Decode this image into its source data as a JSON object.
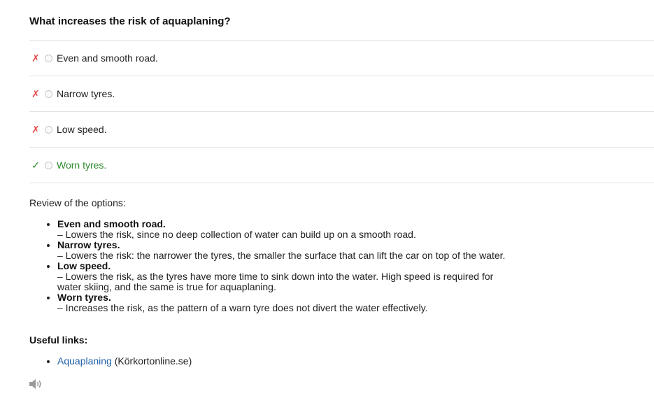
{
  "question": "What increases the risk of aquaplaning?",
  "options": [
    {
      "mark": "✗",
      "text": "Even and smooth road.",
      "correct": false
    },
    {
      "mark": "✗",
      "text": "Narrow tyres.",
      "correct": false
    },
    {
      "mark": "✗",
      "text": "Low speed.",
      "correct": false
    },
    {
      "mark": "✓",
      "text": "Worn tyres.",
      "correct": true
    }
  ],
  "review": {
    "heading": "Review of the options:",
    "items": [
      {
        "title": "Even and smooth road.",
        "desc": "– Lowers the risk, since no deep collection of water can build up on a smooth road."
      },
      {
        "title": "Narrow tyres.",
        "desc": "– Lowers the risk: the narrower the tyres, the smaller the surface that can lift the car on top of the water."
      },
      {
        "title": "Low speed.",
        "desc": "– Lowers the risk, as the tyres have more time to sink down into the water. High speed is required for water skiing, and the same is true for aquaplaning."
      },
      {
        "title": "Worn tyres.",
        "desc": "– Increases the risk, as the pattern of a warn tyre does not divert the water effectively."
      }
    ]
  },
  "links": {
    "heading": "Useful links:",
    "items": [
      {
        "link_text": "Aquaplaning",
        "suffix": " (Körkortonline.se)"
      }
    ]
  },
  "colors": {
    "wrong_mark": "#e24a4a",
    "correct": "#2e8b2e",
    "link": "#1f5fa8"
  },
  "icons": {
    "audio": "speaker-icon"
  }
}
